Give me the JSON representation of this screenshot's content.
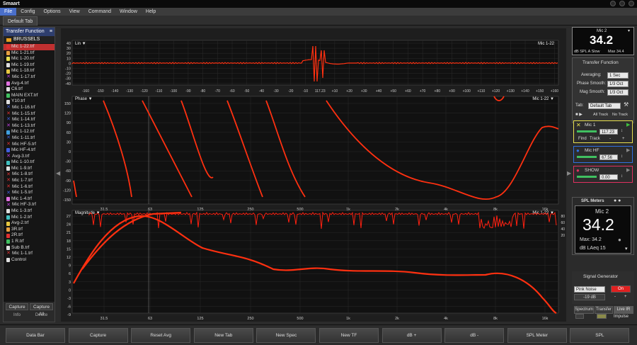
{
  "window": {
    "title": "Smaart"
  },
  "menu": [
    "File",
    "Config",
    "Options",
    "View",
    "Command",
    "Window",
    "Help"
  ],
  "tab": "Default Tab",
  "left_panel": {
    "title": "Transfer Function",
    "folder": "BRUSSELS",
    "files": [
      {
        "name": "Mic 1-22.trf",
        "color": "#e03030"
      },
      {
        "name": "Mic 1-21.trf",
        "color": "#e8a040"
      },
      {
        "name": "Mic 1-20.trf",
        "color": "#e8e050"
      },
      {
        "name": "Mic 1-19.trf",
        "color": "#e0e0e0"
      },
      {
        "name": "Mic 1-18.trf",
        "color": "#e8c840"
      },
      {
        "name": "Mic 1-17.trf",
        "color": "#c040e0",
        "x": true
      },
      {
        "name": "Avg-4.trf",
        "color": "#e070e0"
      },
      {
        "name": "C6.trf",
        "color": "#e0e0e0"
      },
      {
        "name": "MAIN EXT.trf",
        "color": "#40c060"
      },
      {
        "name": "Y10.trf",
        "color": "#e0e0e0"
      },
      {
        "name": "Mic 1-16.trf",
        "color": "#4060e0",
        "x": true
      },
      {
        "name": "Mic 1-15.trf",
        "color": "#e03030",
        "x": true
      },
      {
        "name": "Mic 1-14.trf",
        "color": "#4060e0",
        "x": true
      },
      {
        "name": "Mic 1-13.trf",
        "color": "#c040e0",
        "x": true
      },
      {
        "name": "Mic 1-12.trf",
        "color": "#40a0e0"
      },
      {
        "name": "Mic 1-11.trf",
        "color": "#4060e0",
        "x": true
      },
      {
        "name": "Mic HF-5.trf",
        "color": "#e03030",
        "x": true
      },
      {
        "name": "Mic HF-4.trf",
        "color": "#4060e0"
      },
      {
        "name": "Avg-3.trf",
        "color": "#c040e0",
        "x": true
      },
      {
        "name": "Mic 1-10.trf",
        "color": "#40c0c0"
      },
      {
        "name": "Mic 1-9.trf",
        "color": "#e0e0e0"
      },
      {
        "name": "Mic 1-8.trf",
        "color": "#e03030",
        "x": true
      },
      {
        "name": "Mic 1-7.trf",
        "color": "#e03030",
        "x": true
      },
      {
        "name": "Mic 1-6.trf",
        "color": "#e03030",
        "x": true
      },
      {
        "name": "Mic 1-5.trf",
        "color": "#4060e0",
        "x": true
      },
      {
        "name": "Mic 1-4.trf",
        "color": "#e070e0"
      },
      {
        "name": "Mic HF-3.trf",
        "color": "#c040e0",
        "x": true
      },
      {
        "name": "Mic 1-3.trf",
        "color": "#e0e0e0"
      },
      {
        "name": "Mic 1-2.trf",
        "color": "#40c0c0"
      },
      {
        "name": "Avg-2.trf",
        "color": "#e8c840"
      },
      {
        "name": "3R.trf",
        "color": "#e8a040"
      },
      {
        "name": "2R.trf",
        "color": "#e03030"
      },
      {
        "name": "1 R.trf",
        "color": "#40c060"
      },
      {
        "name": "Sub B.trf",
        "color": "#e0e0e0"
      },
      {
        "name": "Mic 1-1.trf",
        "color": "#e03030",
        "x": true
      },
      {
        "name": "Control",
        "color": "#e0e0e0"
      }
    ],
    "capture": "Capture",
    "capture_all": "Capture All",
    "info": "Info",
    "delete": "Delete"
  },
  "plots": {
    "ir_label": "Lin",
    "ir_mic": "Mic 1-22",
    "ir_yticks": [
      "40",
      "30",
      "20",
      "10",
      "0",
      "-10",
      "-20",
      "-30",
      "-40"
    ],
    "ir_xticks": [
      "-160",
      "-150",
      "-140",
      "-130",
      "-120",
      "-110",
      "-100",
      "-90",
      "-80",
      "-70",
      "-60",
      "-50",
      "-40",
      "-30",
      "-20",
      "-10",
      "117.23",
      "+10",
      "+20",
      "+30",
      "+40",
      "+50",
      "+60",
      "+70",
      "+80",
      "+90",
      "+100",
      "+110",
      "+120",
      "+130",
      "+140",
      "+150",
      "+160"
    ],
    "phase_label": "Phase",
    "phase_mic": "Mic 1-22",
    "phase_yticks": [
      "150",
      "120",
      "90",
      "60",
      "30",
      "0",
      "-30",
      "-60",
      "-90",
      "-120",
      "-150"
    ],
    "freq_ticks": [
      "31.5",
      "63",
      "125",
      "250",
      "500",
      "1k",
      "2k",
      "4k",
      "8k",
      "16k"
    ],
    "mag_label": "Magnitude",
    "mag_mic": "Mic 1-22",
    "mag_yticks": [
      "27",
      "24",
      "21",
      "18",
      "15",
      "12",
      "9",
      "6",
      "3",
      "0",
      "-3",
      "-6",
      "-9"
    ],
    "coh_ticks": [
      "80",
      "60",
      "40",
      "20"
    ]
  },
  "spl_top": {
    "label": "Mic 2",
    "value": "34.2",
    "unit": "dB SPL A Slow",
    "max": "Max 34.4"
  },
  "transfer": {
    "title": "Transfer Function",
    "averaging_label": "Averaging:",
    "averaging": "1 Sec",
    "phase_smooth_label": "Phase Smooth:",
    "phase_smooth": "1/3 Oct",
    "mag_smooth_label": "Mag Smooth:",
    "mag_smooth": "1/3 Oct",
    "tab_label": "Tab:",
    "tab_value": "Default Tab",
    "all_track": "All Track",
    "no_track": "No Track"
  },
  "measurements": [
    {
      "name": "Mic 1",
      "delay": "117.23",
      "color": "#e8e050",
      "find": "Find",
      "track": "Track",
      "minus": "-",
      "plus": "+"
    },
    {
      "name": "Mic HF",
      "delay": "67.56",
      "color": "#3070e0"
    },
    {
      "name": "SHOW",
      "delay": "0.00",
      "color": "#e03060"
    }
  ],
  "spl_meter": {
    "title": "SPL Meters",
    "mic": "Mic 2",
    "value": "34.2",
    "max": "Max: 34.2",
    "unit": "dB LAeq 15"
  },
  "signal": {
    "title": "Signal Generator",
    "type": "Pink Noise",
    "on": "On",
    "level": "-19 dB",
    "minus": "-",
    "plus": "+"
  },
  "view_tabs": [
    "Spectrum",
    "Transfer",
    "Live IR"
  ],
  "impulse": "Impulse",
  "buttons": [
    "Data Bar",
    "Capture",
    "Reset Avg",
    "New Tab",
    "New Spec",
    "New TF",
    "dB +",
    "dB -",
    "SPL Meter",
    "SPL"
  ]
}
